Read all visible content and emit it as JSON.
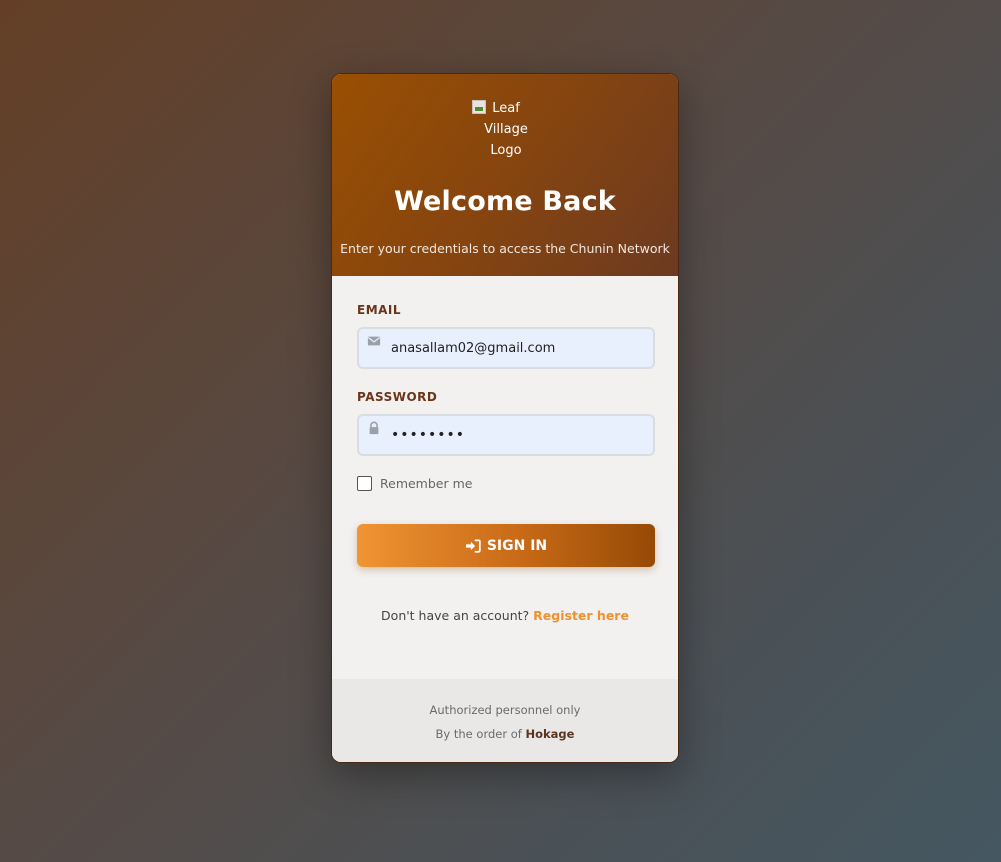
{
  "header": {
    "logo_alt": "Leaf Village Logo",
    "title": "Welcome Back",
    "subtitle": "Enter your credentials to access the Chunin Network"
  },
  "form": {
    "email_label": "EMAIL",
    "email_value": "anasallam02@gmail.com",
    "password_label": "PASSWORD",
    "password_value": "••••••••",
    "remember_label": "Remember me",
    "remember_checked": false,
    "signin_label": "SIGN IN"
  },
  "register": {
    "prompt": "Don't have an account?",
    "link_label": "Register here"
  },
  "footer": {
    "line1": "Authorized personnel only",
    "line2_prefix": "By the order of",
    "line2_name": "Hokage"
  },
  "icons": {
    "email": "envelope-icon",
    "password": "lock-icon",
    "signin": "sign-in-icon"
  },
  "colors": {
    "accent": "#ef9130",
    "header_start": "#9a4f02",
    "header_end": "#6c3a21",
    "label": "#6b3519"
  }
}
